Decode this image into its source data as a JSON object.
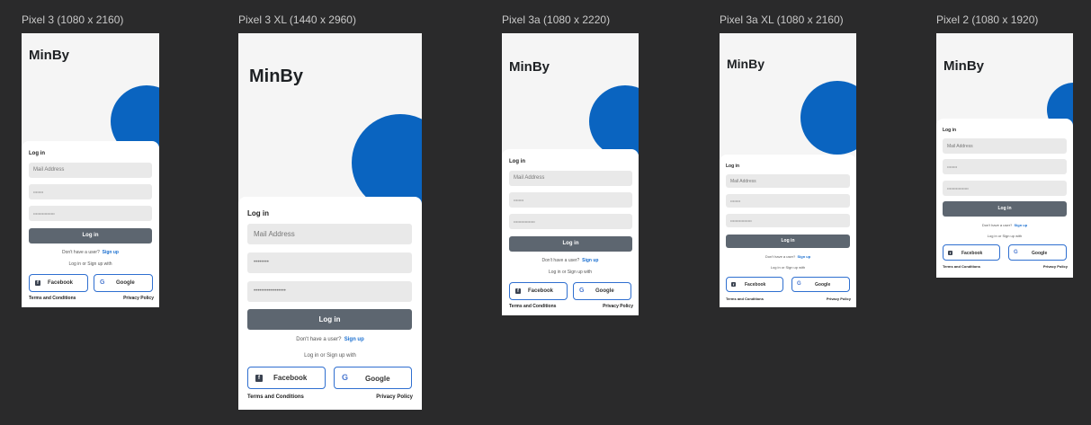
{
  "devices": [
    {
      "label": "Pixel 3 (1080 x 2160)"
    },
    {
      "label": "Pixel 3 XL (1440 x 2960)"
    },
    {
      "label": "Pixel 3a (1080 x 2220)"
    },
    {
      "label": "Pixel 3a XL (1080 x 2160)"
    },
    {
      "label": "Pixel 2 (1080 x 1920)"
    }
  ],
  "app": {
    "brand": "MinBy",
    "login_title": "Log in",
    "mail_placeholder": "Mail Address",
    "password_mask_1": "••••••••",
    "password_mask_2": "•••••••••••••••••",
    "login_button": "Log in",
    "no_user_text": "Don't have a user?",
    "sign_up_link": "Sign up",
    "social_caption": "Log in or Sign up with",
    "facebook_label": "Facebook",
    "google_label": "Google",
    "facebook_icon_glyph": "f",
    "google_icon_glyph": "G",
    "terms": "Terms and Conditions",
    "privacy": "Privacy Policy"
  },
  "colors": {
    "background": "#2a2a2b",
    "accent_circle": "#0a64c0",
    "login_button": "#5d6670",
    "link": "#1a6fd0"
  }
}
